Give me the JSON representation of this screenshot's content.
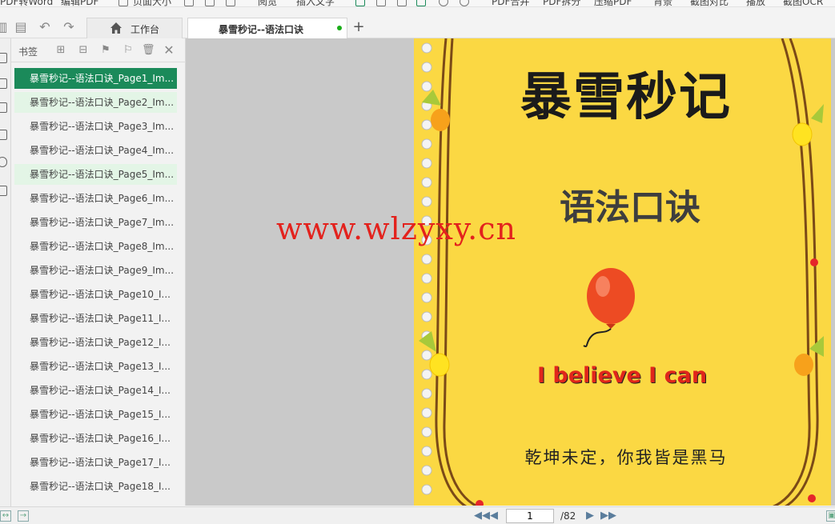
{
  "toolbar": {
    "items": [
      "PDF转Word",
      "编辑PDF",
      "页面大小",
      "阅览",
      "插入文字",
      "PDF合并",
      "PDF拆分",
      "压缩PDF",
      "背景",
      "截图对比",
      "播放",
      "截图OCR"
    ]
  },
  "tabs": {
    "home_label": "工作台",
    "doc_label": "暴雪秒记--语法口诀"
  },
  "bookmarks": {
    "title": "书签",
    "items": [
      "暴雪秒记--语法口诀_Page1_Im...",
      "暴雪秒记--语法口诀_Page2_Im...",
      "暴雪秒记--语法口诀_Page3_Im...",
      "暴雪秒记--语法口诀_Page4_Im...",
      "暴雪秒记--语法口诀_Page5_Im...",
      "暴雪秒记--语法口诀_Page6_Im...",
      "暴雪秒记--语法口诀_Page7_Im...",
      "暴雪秒记--语法口诀_Page8_Im...",
      "暴雪秒记--语法口诀_Page9_Im...",
      "暴雪秒记--语法口诀_Page10_I...",
      "暴雪秒记--语法口诀_Page11_I...",
      "暴雪秒记--语法口诀_Page12_I...",
      "暴雪秒记--语法口诀_Page13_I...",
      "暴雪秒记--语法口诀_Page14_I...",
      "暴雪秒记--语法口诀_Page15_I...",
      "暴雪秒记--语法口诀_Page16_I...",
      "暴雪秒记--语法口诀_Page17_I...",
      "暴雪秒记--语法口诀_Page18_I..."
    ]
  },
  "document": {
    "title": "暴雪秒记",
    "subtitle": "语法口诀",
    "motto": "I believe I can",
    "footer": "乾坤未定，你我皆是黑马"
  },
  "watermark": "www.wlzyxy.cn",
  "pagination": {
    "current": "1",
    "total": "/82"
  },
  "colors": {
    "accent": "#1b8a5a",
    "page_bg": "#fbd843",
    "watermark": "#e3221d"
  }
}
